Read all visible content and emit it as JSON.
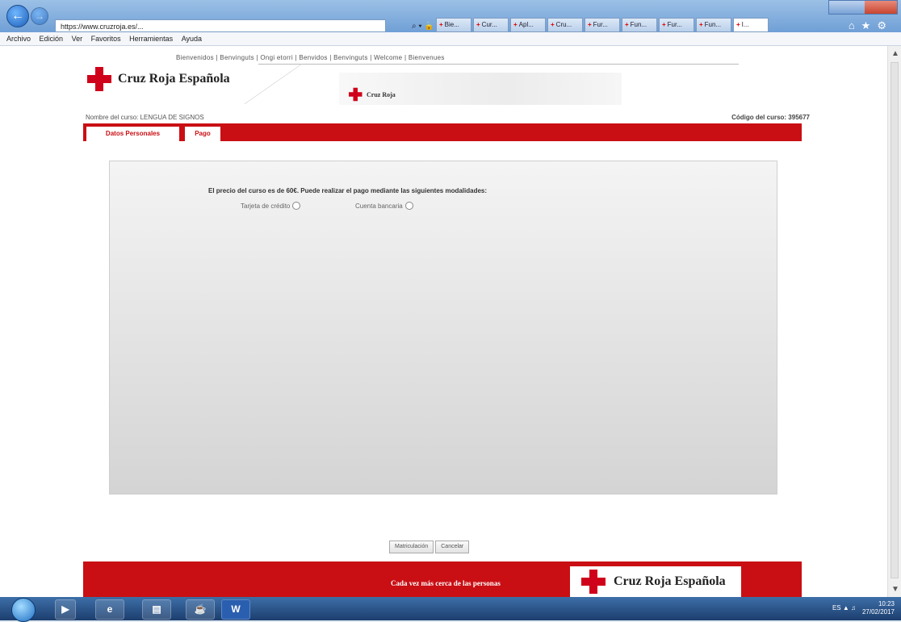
{
  "browser": {
    "address": "https://www.cruzroja.es/...",
    "address_tools": "⌕ ▾ 🔒 ↻",
    "tabs": [
      {
        "label": "Bie..."
      },
      {
        "label": "Cur..."
      },
      {
        "label": "Apl..."
      },
      {
        "label": "Cru..."
      },
      {
        "label": "Fur..."
      },
      {
        "label": "Fun..."
      },
      {
        "label": "Fur..."
      },
      {
        "label": "Fun..."
      },
      {
        "label": "I..."
      }
    ],
    "menu": [
      "Archivo",
      "Edición",
      "Ver",
      "Favoritos",
      "Herramientas",
      "Ayuda"
    ]
  },
  "page": {
    "top_links": "Bienvenidos | Benvinguts | Ongi etorri | Benvidos | Benvinguts | Welcome | Bienvenues",
    "logo_text": "Cruz Roja Española",
    "banner_logo_text": "Cruz Roja",
    "course_name": "Nombre del curso: LENGUA DE SIGNOS",
    "course_code": "Código del curso: 395677",
    "tabs": {
      "personal": "Datos Personales",
      "payment": "Pago"
    },
    "price_text": "El precio del curso es de 60€. Puede realizar el pago mediante las siguientes modalidades:",
    "options": {
      "card": "Tarjeta de crédito",
      "bank": "Cuenta bancaria"
    },
    "buttons": {
      "enroll": "Matriculación",
      "cancel": "Cancelar"
    },
    "footer_slogan": "Cada vez más cerca de las personas",
    "footer_logo_text": "Cruz Roja Española"
  },
  "taskbar": {
    "lang": "ES",
    "time": "10:23",
    "date": "27/02/2017"
  },
  "colors": {
    "brand_red": "#c90f14"
  }
}
